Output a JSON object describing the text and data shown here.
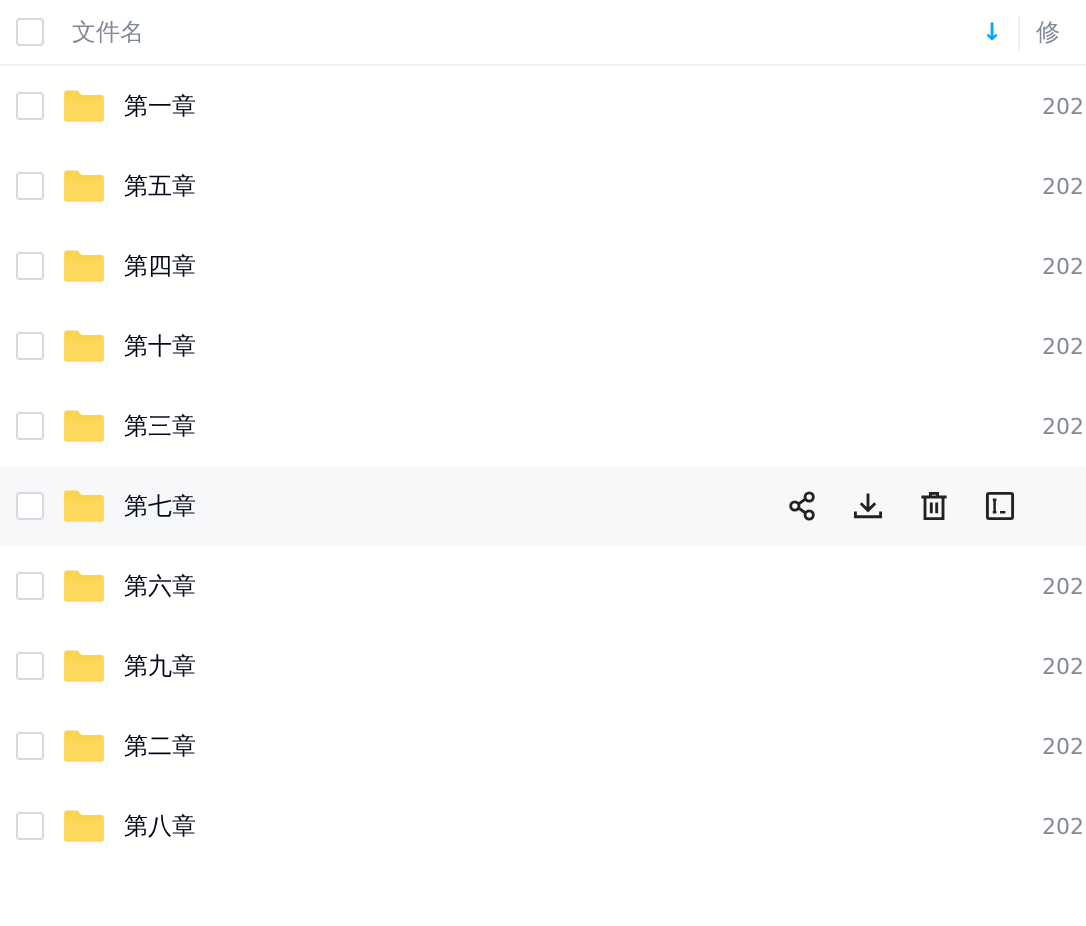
{
  "header": {
    "checked": false,
    "name_column": "文件名",
    "sort_icon": "↓",
    "date_column": "修"
  },
  "rows": [
    {
      "name": "第一章",
      "date": "202",
      "checked": false,
      "hovered": false
    },
    {
      "name": "第五章",
      "date": "202",
      "checked": false,
      "hovered": false
    },
    {
      "name": "第四章",
      "date": "202",
      "checked": false,
      "hovered": false
    },
    {
      "name": "第十章",
      "date": "202",
      "checked": false,
      "hovered": false
    },
    {
      "name": "第三章",
      "date": "202",
      "checked": false,
      "hovered": false
    },
    {
      "name": "第七章",
      "checked": false,
      "hovered": true
    },
    {
      "name": "第六章",
      "date": "202",
      "checked": false,
      "hovered": false
    },
    {
      "name": "第九章",
      "date": "202",
      "checked": false,
      "hovered": false
    },
    {
      "name": "第二章",
      "date": "202",
      "checked": false,
      "hovered": false
    },
    {
      "name": "第八章",
      "date": "202",
      "checked": false,
      "hovered": false
    }
  ]
}
